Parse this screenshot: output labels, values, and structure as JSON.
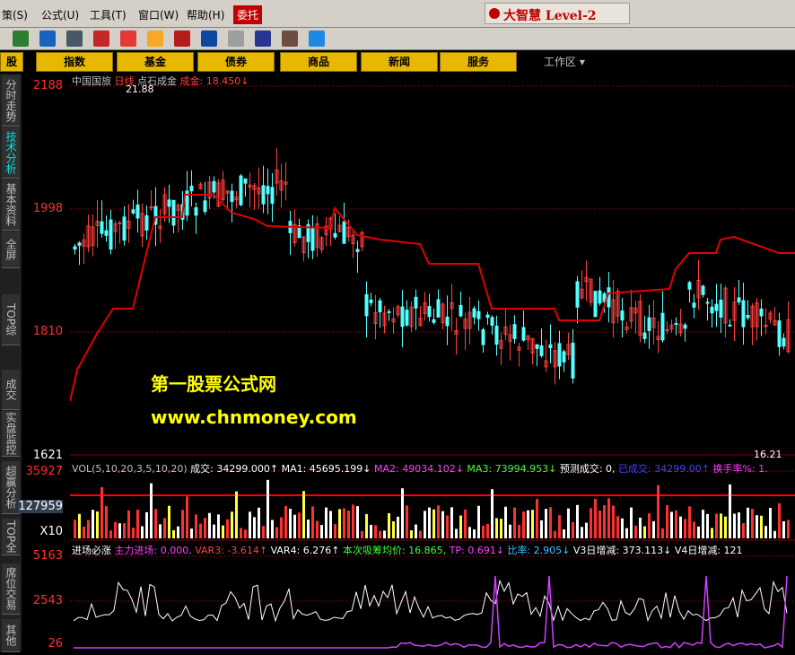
{
  "menu": {
    "items": [
      "策(S)",
      "公式(U)",
      "工具(T)",
      "窗口(W)",
      "帮助(H)"
    ],
    "red_item": "委托",
    "brand": "大智慧 Level-2"
  },
  "navbar": {
    "items": [
      "股",
      "指数",
      "基金",
      "债券",
      "商品",
      "新闻",
      "服务"
    ],
    "workarea": "工作区"
  },
  "sidebar": {
    "tabs": [
      "分时走势",
      "技术分析",
      "基本资料",
      "全屏",
      "TOP综",
      "成交",
      "实盘监控",
      "超赢分析",
      "TOP全",
      "席位交易",
      "其他"
    ]
  },
  "price_axis": {
    "labels": [
      "2188",
      "1998",
      "1810",
      "1621"
    ]
  },
  "vol_axis": {
    "labels": [
      "35927",
      "127959",
      "X10"
    ]
  },
  "ind_axis": {
    "labels": [
      "5163",
      "2543",
      "26"
    ]
  },
  "chart_header": {
    "name": "中国国旅",
    "period": "日线",
    "indicator": "点石成金",
    "value": "成金: 18.450↓",
    "high_marker": "21.88",
    "low_marker": "16.21"
  },
  "vol_header": {
    "text": "VOL(5,10,20,3,5,10,20)",
    "cj": "成交: 34299.000↑",
    "ma1": "MA1: 45695.199↓",
    "ma2": "MA2: 49034.102↓",
    "ma3": "MA3: 73994.953↓",
    "yc": "预测成交: 0,",
    "yc2": "已成交: 34299.00↑",
    "hsl": "换手率%: 1."
  },
  "ind_header": {
    "t1": "进场必涨",
    "t2": "主力进场: 0.000,",
    "t3": "VAR3: -3.614↑",
    "t4": "VAR4: 6.276↑",
    "t5": "本次吸筹均价: 16.865,",
    "t6": "TP: 0.691↓",
    "t7": "比率: 2.905↓",
    "t8": "V3日增减: 373.113↓",
    "t9": "V4日增减: 121"
  },
  "watermark": {
    "line1": "第一股票公式网",
    "line2": "www.chnmoney.com"
  },
  "chart_data": {
    "type": "line",
    "title": "",
    "ylim": [
      16.21,
      21.88
    ]
  }
}
